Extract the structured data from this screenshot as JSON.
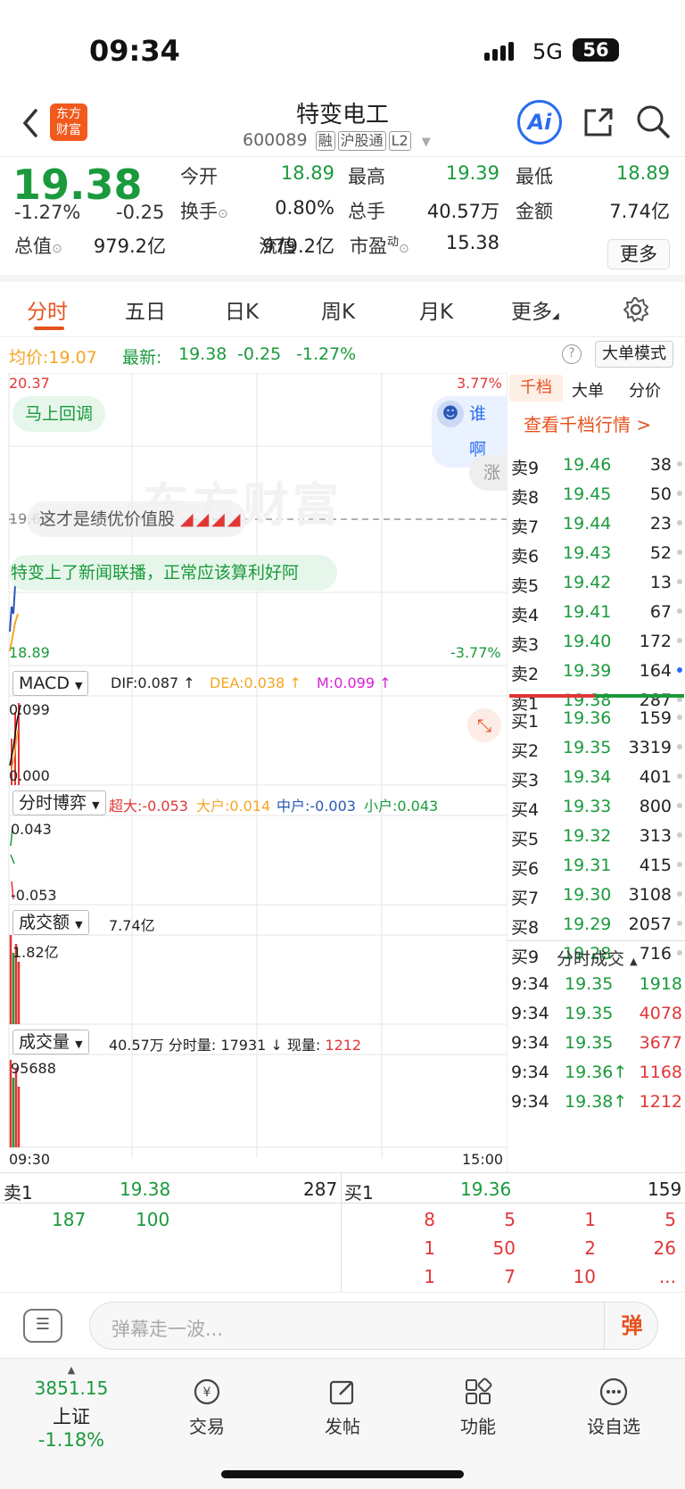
{
  "status": {
    "time": "09:34",
    "network": "5G",
    "battery": "56"
  },
  "header": {
    "logo": "东方\n财富",
    "name": "特变电工",
    "code": "600089",
    "tags": [
      "融",
      "沪股通",
      "L2"
    ]
  },
  "quote": {
    "price": "19.38",
    "change_pct": "-1.27%",
    "change": "-0.25",
    "fields": [
      {
        "label": "今开",
        "value": "18.89",
        "color": "g"
      },
      {
        "label": "最高",
        "value": "19.39",
        "color": "g"
      },
      {
        "label": "最低",
        "value": "18.89",
        "color": "g"
      },
      {
        "label": "换手",
        "value": "0.80%",
        "color": ""
      },
      {
        "label": "总手",
        "value": "40.57万",
        "color": ""
      },
      {
        "label": "金额",
        "value": "7.74亿",
        "color": ""
      },
      {
        "label": "总值",
        "value": "979.2亿",
        "color": ""
      },
      {
        "label": "流值",
        "value": "979.2亿",
        "color": ""
      },
      {
        "label": "市盈",
        "sup": "动",
        "value": "15.38",
        "color": ""
      }
    ],
    "more": "更多"
  },
  "tabs": [
    "分时",
    "五日",
    "日K",
    "周K",
    "月K",
    "更多"
  ],
  "info": {
    "avg_label": "均价:",
    "avg": "19.07",
    "latest_label": "最新:",
    "latest": "19.38",
    "chg": "-0.25",
    "pct": "-1.27%",
    "bigorder": "大单模式"
  },
  "chart": {
    "hi": "20.37",
    "hi_pct": "3.77%",
    "mid": "19.63",
    "lo": "18.89",
    "lo_pct": "-3.77%",
    "bubbles": [
      "马上回调",
      "谁啊",
      "这才是绩优价值股",
      "特变上了新闻联播，正常应该算利好阿",
      "涨"
    ],
    "watermark": "东方财富",
    "macd": {
      "sel": "MACD",
      "dif": "DIF:0.087 ↑",
      "dea": "DEA:0.038 ↑",
      "m": "M:0.099 ↑",
      "top": "0.099",
      "bot": "0.000"
    },
    "game": {
      "sel": "分时博弈",
      "super": "超大:-0.053",
      "big": "大户:0.014",
      "mid": "中户:-0.003",
      "small": "小户:0.043",
      "top": "0.043",
      "bot": "-0.053"
    },
    "amount": {
      "sel": "成交额",
      "val": "7.74亿",
      "axis": "1.82亿"
    },
    "volume": {
      "sel": "成交量",
      "total": "40.57万",
      "min_label": "分时量:",
      "min": "17931 ↓",
      "now_label": "现量:",
      "now": "1212",
      "axis": "95688"
    },
    "time_start": "09:30",
    "time_end": "15:00"
  },
  "orderbook": {
    "tabs": [
      "千档",
      "大单",
      "分价"
    ],
    "link": "查看千档行情 >",
    "asks": [
      [
        "卖9",
        "19.46",
        "38"
      ],
      [
        "卖8",
        "19.45",
        "50"
      ],
      [
        "卖7",
        "19.44",
        "23"
      ],
      [
        "卖6",
        "19.43",
        "52"
      ],
      [
        "卖5",
        "19.42",
        "13"
      ],
      [
        "卖4",
        "19.41",
        "67"
      ],
      [
        "卖3",
        "19.40",
        "172"
      ],
      [
        "卖2",
        "19.39",
        "164"
      ],
      [
        "卖1",
        "19.38",
        "287"
      ]
    ],
    "bids": [
      [
        "买1",
        "19.36",
        "159"
      ],
      [
        "买2",
        "19.35",
        "3319"
      ],
      [
        "买3",
        "19.34",
        "401"
      ],
      [
        "买4",
        "19.33",
        "800"
      ],
      [
        "买5",
        "19.32",
        "313"
      ],
      [
        "买6",
        "19.31",
        "415"
      ],
      [
        "买7",
        "19.30",
        "3108"
      ],
      [
        "买8",
        "19.29",
        "2057"
      ],
      [
        "买9",
        "19.28",
        "716"
      ]
    ],
    "trades_title": "分时成交",
    "trades": [
      [
        "9:34",
        "19.35",
        "1918",
        ""
      ],
      [
        "9:34",
        "19.35",
        "4078",
        ""
      ],
      [
        "9:34",
        "19.35",
        "3677",
        ""
      ],
      [
        "9:34",
        "19.36↑",
        "1168",
        ""
      ],
      [
        "9:34",
        "19.38↑",
        "1212",
        ""
      ]
    ]
  },
  "depth": {
    "sell_label": "卖1",
    "sell_price": "19.38",
    "sell_vol": "287",
    "buy_label": "买1",
    "buy_price": "19.36",
    "buy_vol": "159",
    "sell_q": [
      "187",
      "100"
    ],
    "buy_q1": [
      "8",
      "5",
      "1",
      "5"
    ],
    "buy_q2": [
      "1",
      "50",
      "2",
      "26"
    ],
    "buy_q3": [
      "1",
      "7",
      "10",
      "..."
    ]
  },
  "comment": {
    "placeholder": "弹幕走一波...",
    "danmu": "弹"
  },
  "footer": {
    "index": "3851.15",
    "index_name": "上证",
    "index_pct": "-1.18%",
    "items": [
      "交易",
      "发帖",
      "功能",
      "设自选"
    ]
  }
}
